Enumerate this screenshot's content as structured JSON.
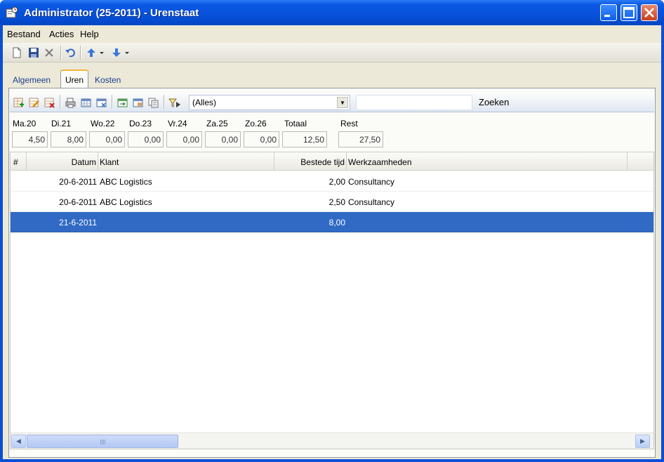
{
  "window": {
    "title": "Administrator (25-2011) - Urenstaat"
  },
  "menu": [
    "Bestand",
    "Acties",
    "Help"
  ],
  "toolbar_icons": [
    "new-icon",
    "save-icon",
    "delete-icon",
    "undo-icon",
    "arrow-up-icon",
    "arrow-down-icon"
  ],
  "tabs": [
    {
      "label": "Algemeen",
      "active": false
    },
    {
      "label": "Uren",
      "active": true
    },
    {
      "label": "Kosten",
      "active": false
    }
  ],
  "subtoolbar": {
    "filter_value": "(Alles)",
    "search_value": "",
    "search_label": "Zoeken"
  },
  "days": [
    {
      "label": "Ma.20",
      "value": "4,50"
    },
    {
      "label": "Di.21",
      "value": "8,00"
    },
    {
      "label": "Wo.22",
      "value": "0,00"
    },
    {
      "label": "Do.23",
      "value": "0,00"
    },
    {
      "label": "Vr.24",
      "value": "0,00"
    },
    {
      "label": "Za.25",
      "value": "0,00"
    },
    {
      "label": "Zo.26",
      "value": "0,00"
    },
    {
      "label": "Totaal",
      "value": "12,50"
    },
    {
      "label": "Rest",
      "value": "27,50"
    }
  ],
  "grid": {
    "columns": [
      "#",
      "Datum",
      "Klant",
      "Bestede tijd",
      "Werkzaamheden"
    ],
    "rows": [
      {
        "datum": "20-6-2011",
        "klant": "ABC Logistics",
        "tijd": "2,00",
        "werk": "Consultancy",
        "selected": false
      },
      {
        "datum": "20-6-2011",
        "klant": "ABC Logistics",
        "tijd": "2,50",
        "werk": "Consultancy",
        "selected": false
      },
      {
        "datum": "21-6-2011",
        "klant": "",
        "tijd": "8,00",
        "werk": "",
        "selected": true
      }
    ]
  },
  "colors": {
    "title_bar": "#0750d9",
    "selection": "#316ac5",
    "window_bg": "#ece9d8"
  }
}
